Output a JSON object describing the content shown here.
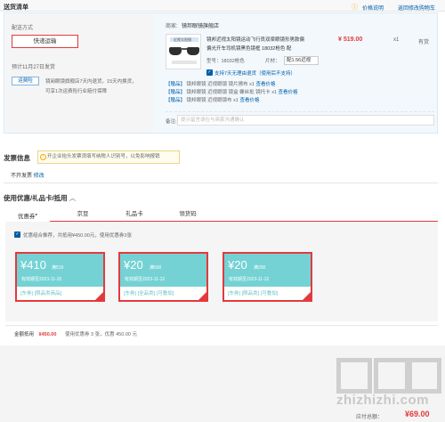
{
  "header": {
    "title": "送货清单",
    "price_notice": "价格说明",
    "back_link": "返回修改购物车"
  },
  "shipping": {
    "label": "配送方式",
    "method": "快递运输",
    "eta": "预计11月27日发货",
    "pickup_tag": "运费险",
    "pickup_text_1": "镜阅眼镜旗舰店7天内退货，15天内换货，",
    "pickup_text_2": "可享1次运费险行业赔付保障"
  },
  "store": {
    "label": "商家:",
    "name": "镜邦眼镜旗舰店"
  },
  "product": {
    "title_1": "镜邦近视太阳镜运动飞行员双梁眼镜形男款偏",
    "title_2": "偏光开车司机镜黑色镜框 18032枪色 配",
    "price": "¥ 519.00",
    "qty": "x1",
    "stock": "有货",
    "spec_model": "型号：18032枪色",
    "spec_lens_label": "片材：",
    "spec_lens_value": "配1.56近视太...",
    "notice": "支持7天无理由退货（使用后不支持）",
    "image_caption": "近视太阳镜",
    "gifts": [
      {
        "tag": "【赠品】",
        "name": "镜邦眼镜 近视眼镜 镜片擦布",
        "qty": "x1",
        "link": "查看价格"
      },
      {
        "tag": "【赠品】",
        "name": "镜邦眼镜 近视眼镜 镜盒 螺丝批 镜托卡",
        "qty": "x1",
        "link": "查看价格"
      },
      {
        "tag": "【赠品】",
        "name": "镜邦眼镜 近视眼镜布",
        "qty": "x1",
        "link": "查看价格"
      }
    ],
    "remark_label": "备注:",
    "remark_placeholder": "提示留言请在与商家沟通确认"
  },
  "invoice": {
    "title": "发票信息",
    "tip": "开企业抬头发票须填写纳税人识别号，以免影响报销",
    "status": "不开发票",
    "edit": "修改"
  },
  "coupons": {
    "title": "使用优惠/礼品卡/抵用",
    "tabs": [
      "优惠券",
      "京豆",
      "礼品卡",
      "领货码"
    ],
    "active_tab_mark": "●",
    "checkbox_label": "优惠组合推荐，共抵用¥450.00元，使用优惠券3张",
    "items": [
      {
        "value": "¥410",
        "condition": "满519",
        "date": "有效期至2023-11-15",
        "tags": "[东券]  [限品类商品]"
      },
      {
        "value": "¥20",
        "condition": "满500",
        "date": "有效期至2023-11-12",
        "tags": "[东券]  [全品类]  [可叠加]"
      },
      {
        "value": "¥20",
        "condition": "满200",
        "date": "有效期至2023-11-12",
        "tags": "[东券]  [限品类]  [可叠加]"
      }
    ],
    "summary_label": "金额抵用",
    "summary_amount": "¥450.00",
    "summary_detail": "使用优惠券 3 张，优惠 450.00 元"
  },
  "footer": {
    "total_label": "应付总额：",
    "total": "¥69.00",
    "watermark": "zhizhizhi.com"
  },
  "colors": {
    "accent_red": "#e4393c",
    "link_blue": "#005ea7",
    "coupon_teal": "#74d2d4"
  }
}
